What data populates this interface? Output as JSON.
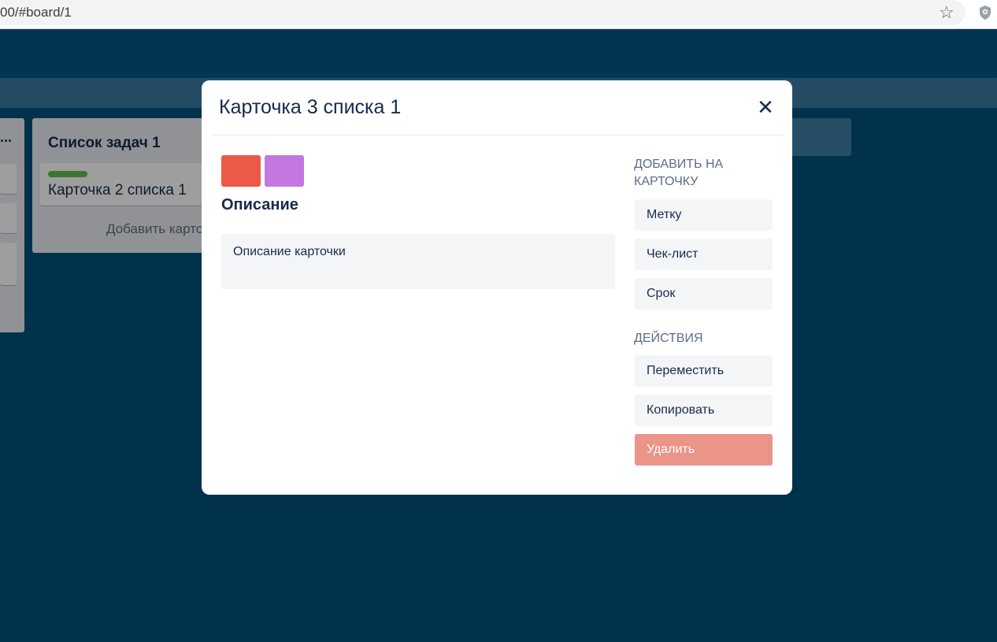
{
  "browser": {
    "url": "00/#board/1",
    "star_icon": "star-icon",
    "extension_icon": "shield-icon"
  },
  "board": {
    "list_left": {
      "title_ellipsis": "..."
    },
    "list_main": {
      "title": "Список задач 1",
      "card_text": "Карточка 2 списка 1",
      "card_label_color": "#61bd4f",
      "add_card": "Добавить карто"
    }
  },
  "modal": {
    "title": "Карточка 3 списка 1",
    "close_symbol": "✕",
    "labels": [
      {
        "color": "#eb5a46"
      },
      {
        "color": "#c377e0"
      }
    ],
    "description_heading": "Описание",
    "description_text": "Описание карточки",
    "add_section": {
      "heading": "ДОБАВИТЬ НА КАРТОЧКУ",
      "buttons": [
        "Метку",
        "Чек-лист",
        "Срок"
      ]
    },
    "actions_section": {
      "heading": "ДЕЙСТВИЯ",
      "buttons": [
        "Переместить",
        "Копировать",
        "Удалить"
      ],
      "delete_color": "#eb9488"
    }
  }
}
